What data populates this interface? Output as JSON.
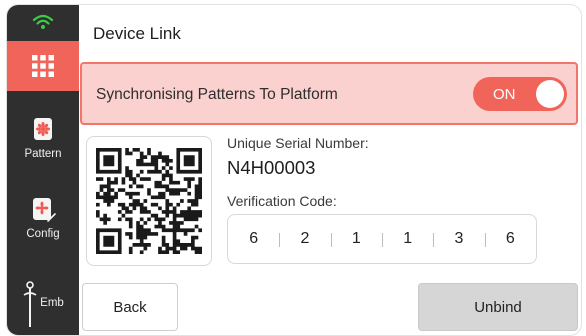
{
  "header": {
    "title": "Device Link"
  },
  "sidebar": {
    "items": [
      {
        "label": "Pattern"
      },
      {
        "label": "Config"
      },
      {
        "label": "Emb"
      }
    ]
  },
  "sync": {
    "label": "Synchronising Patterns To Platform",
    "toggle_text": "ON",
    "enabled": true
  },
  "device": {
    "serial_label": "Unique Serial Number:",
    "serial_value": "N4H00003",
    "code_label": "Verification Code:",
    "code_digits": [
      "6",
      "2",
      "1",
      "1",
      "3",
      "6"
    ]
  },
  "buttons": {
    "back": "Back",
    "unbind": "Unbind"
  },
  "colors": {
    "accent": "#f1645a",
    "sync_bg": "#fbd1cf",
    "sidebar": "#2f2f2f"
  },
  "icons": [
    "wifi-icon",
    "apps-grid-icon",
    "pattern-icon",
    "config-icon",
    "embroidery-icon",
    "qr-code-icon"
  ]
}
